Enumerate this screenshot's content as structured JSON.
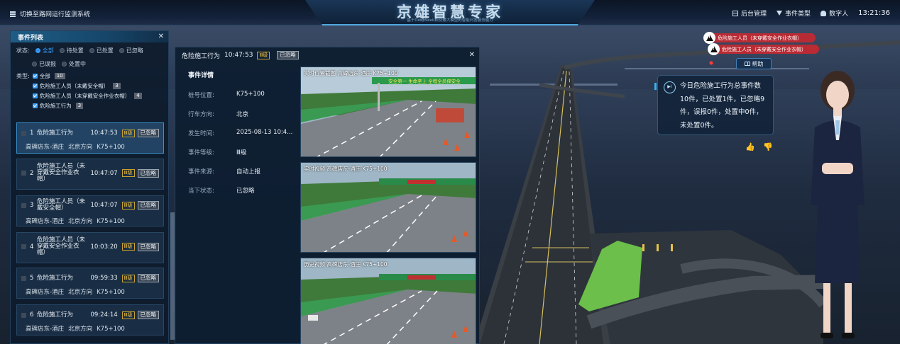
{
  "topbar": {
    "switch_label": "切换至路网运行监测系统",
    "title": "京雄智慧专家",
    "subtitle": "基于DeepSeek和交通大模型的智能问答服务能力",
    "menu": [
      {
        "icon": "grid-icon",
        "label": "后台管理"
      },
      {
        "icon": "filter-icon",
        "label": "事件类型"
      },
      {
        "icon": "person-icon",
        "label": "数字人"
      }
    ],
    "clock": "13:21:36"
  },
  "list_panel": {
    "title": "事件列表",
    "status_label": "状态:",
    "status_options": [
      "全部",
      "待处置",
      "已处置",
      "已忽略",
      "已误报",
      "处置中"
    ],
    "type_label": "类型:",
    "types": [
      {
        "label": "全部",
        "count": "10"
      },
      {
        "label": "危险施工人员（未戴安全帽）",
        "count": "3"
      },
      {
        "label": "危险施工人员（未穿戴安全作业衣帽）",
        "count": "4"
      },
      {
        "label": "危险施工行为",
        "count": "3"
      }
    ],
    "events": [
      {
        "num": "1",
        "type": "危险施工行为",
        "time": "10:47:53",
        "level": "Ⅲ级",
        "status": "已忽略",
        "section": "高碑店东-酒庄",
        "direction": "北京方向",
        "stake": "K75+100"
      },
      {
        "num": "2",
        "type": "危险施工人员（未穿戴安全作业衣帽）",
        "time": "10:47:07",
        "level": "Ⅲ级",
        "status": "已忽略"
      },
      {
        "num": "3",
        "type": "危险施工人员（未戴安全帽）",
        "time": "10:47:07",
        "level": "Ⅲ级",
        "status": "已忽略",
        "section": "高碑店东-酒庄",
        "direction": "北京方向",
        "stake": "K75+100"
      },
      {
        "num": "4",
        "type": "危险施工人员（未穿戴安全作业衣帽）",
        "time": "10:03:20",
        "level": "Ⅲ级",
        "status": "已忽略"
      },
      {
        "num": "5",
        "type": "危险施工行为",
        "time": "09:59:33",
        "level": "Ⅲ级",
        "status": "已忽略",
        "section": "高碑店东-酒庄",
        "direction": "北京方向",
        "stake": "K75+100"
      },
      {
        "num": "6",
        "type": "危险施工行为",
        "time": "09:24:14",
        "level": "Ⅲ级",
        "status": "已忽略",
        "section": "高碑店东-酒庄",
        "direction": "北京方向",
        "stake": "K75+100"
      }
    ]
  },
  "detail": {
    "title": "危险施工行为",
    "time": "10:47:53",
    "level": "Ⅲ级",
    "status": "已忽略",
    "section_title": "事件详情",
    "fields": [
      {
        "k": "桩号位置:",
        "v": "K75+100"
      },
      {
        "k": "行车方向:",
        "v": "北京"
      },
      {
        "k": "发生时间:",
        "v": "2025-08-13 10:4..."
      },
      {
        "k": "事件等级:",
        "v": "Ⅲ级"
      },
      {
        "k": "事件来源:",
        "v": "自动上报"
      },
      {
        "k": "当下状态:",
        "v": "已忽略"
      }
    ],
    "cameras": [
      {
        "caption": "实时位置截图  高碑店东-酒庄  K75+100",
        "banner": "安全第一 生命至上 全程全员保安全"
      },
      {
        "caption": "实时视频  高碑店东-酒庄  K75+100",
        "banner": ""
      },
      {
        "caption": "历史视频  高碑店东-酒庄  K75+100",
        "banner": ""
      }
    ]
  },
  "alerts": [
    "危险施工人员（未穿戴安全作业衣帽）",
    "危险施工人员（未穿戴安全作业衣帽）"
  ],
  "help": {
    "label": "帮助"
  },
  "assistant": {
    "message": "今日危险施工行为总事件数10件，已处置1件，已忽略9件，误报0件，处置中0件，未处置0件。"
  },
  "colors": {
    "accent": "#3aa0ff",
    "alert": "#c8282f",
    "level": "#f0c040",
    "road_green": "#6bbf4a"
  }
}
